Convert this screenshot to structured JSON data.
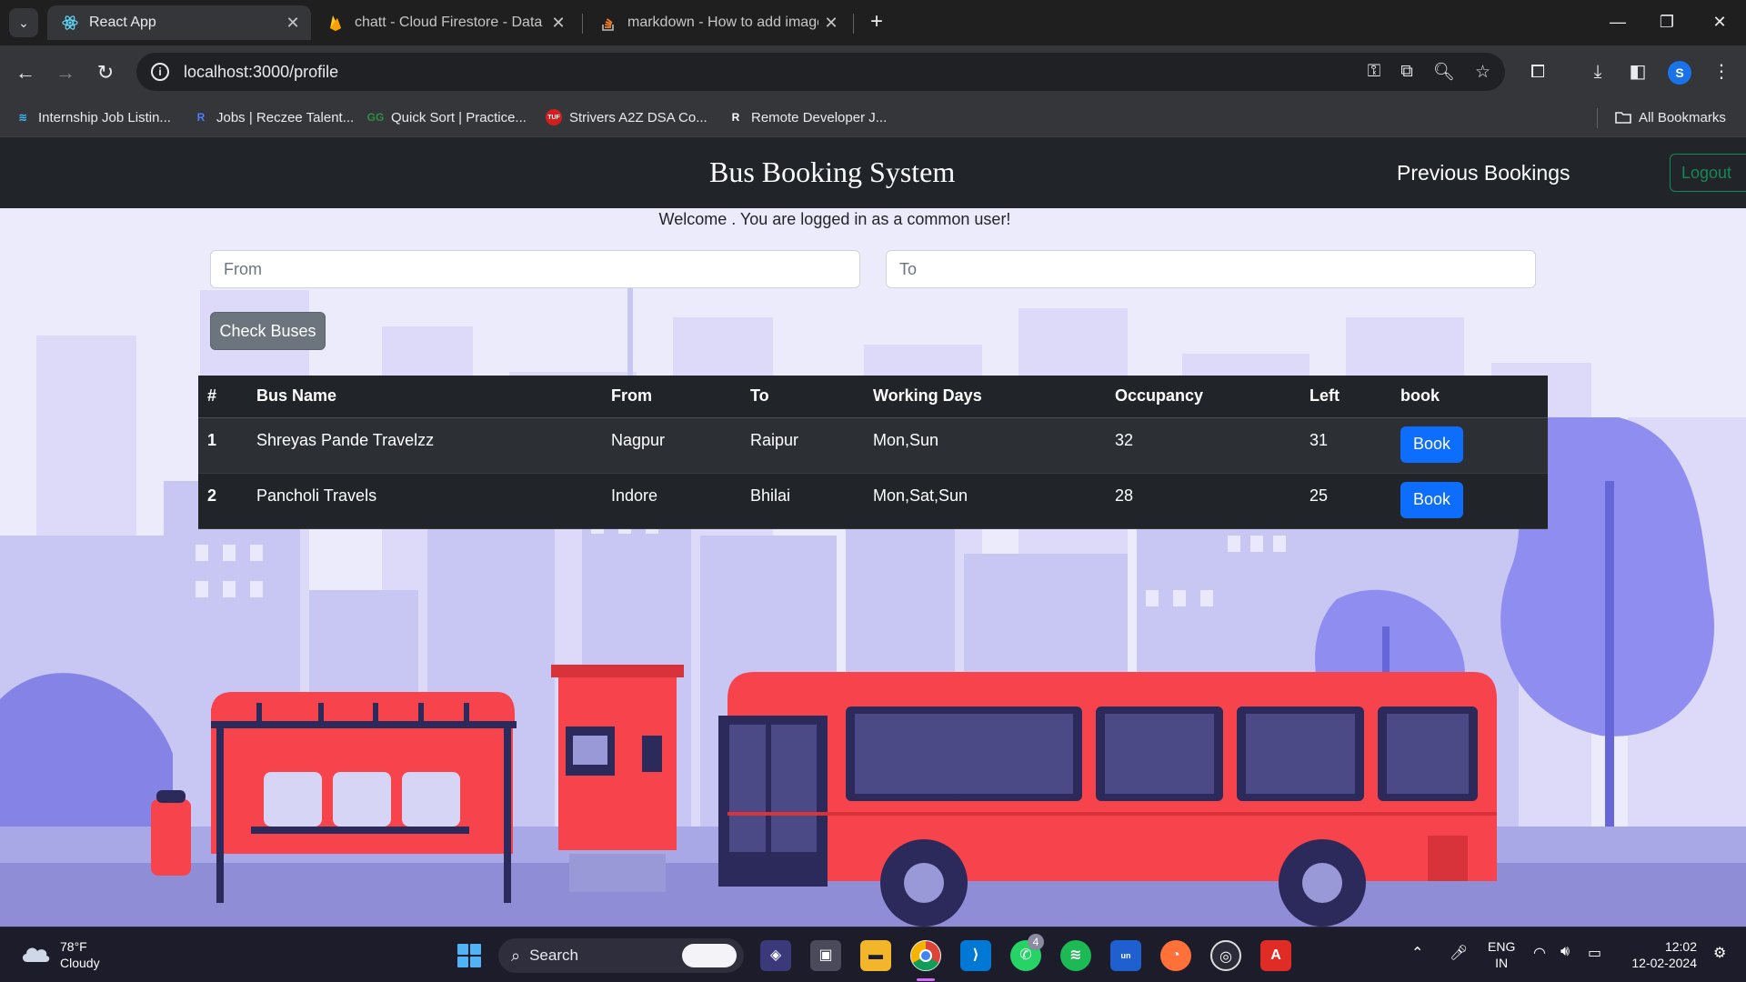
{
  "browser": {
    "tabs": [
      {
        "title": "React App",
        "active": true
      },
      {
        "title": "chatt - Cloud Firestore - Data -",
        "active": false
      },
      {
        "title": "markdown - How to add image",
        "active": false
      }
    ],
    "url": "localhost:3000/profile",
    "bookmarks": [
      "Internship Job Listin...",
      "Jobs | Reczee Talent...",
      "Quick Sort | Practice...",
      "Strivers A2Z DSA Co...",
      "Remote Developer J..."
    ],
    "all_bookmarks": "All Bookmarks",
    "profile_initial": "S"
  },
  "app": {
    "brand": "Bus Booking System",
    "nav_previous": "Previous Bookings",
    "logout": "Logout",
    "welcome": "Welcome . You are logged in as a common user!",
    "from_placeholder": "From",
    "to_placeholder": "To",
    "check_buses": "Check Buses",
    "table": {
      "headers": [
        "#",
        "Bus Name",
        "From",
        "To",
        "Working Days",
        "Occupancy",
        "Left",
        "book"
      ],
      "rows": [
        {
          "num": "1",
          "name": "Shreyas Pande Travelzz",
          "from": "Nagpur",
          "to": "Raipur",
          "days": "Mon,Sun",
          "occupancy": "32",
          "left": "31",
          "action": "Book"
        },
        {
          "num": "2",
          "name": "Pancholi Travels",
          "from": "Indore",
          "to": "Bhilai",
          "days": "Mon,Sat,Sun",
          "occupancy": "28",
          "left": "25",
          "action": "Book"
        }
      ]
    }
  },
  "taskbar": {
    "weather_temp": "78°F",
    "weather_desc": "Cloudy",
    "search": "Search",
    "whatsapp_badge": "4",
    "lang_line1": "ENG",
    "lang_line2": "IN",
    "time": "12:02",
    "date": "12-02-2024"
  },
  "colors": {
    "navbar": "#212529",
    "page_bg": "#ecebfb",
    "book_button": "#0d6efd",
    "logout_outline": "#198754",
    "check_button": "#6c757d",
    "bus_red": "#f7434b"
  }
}
